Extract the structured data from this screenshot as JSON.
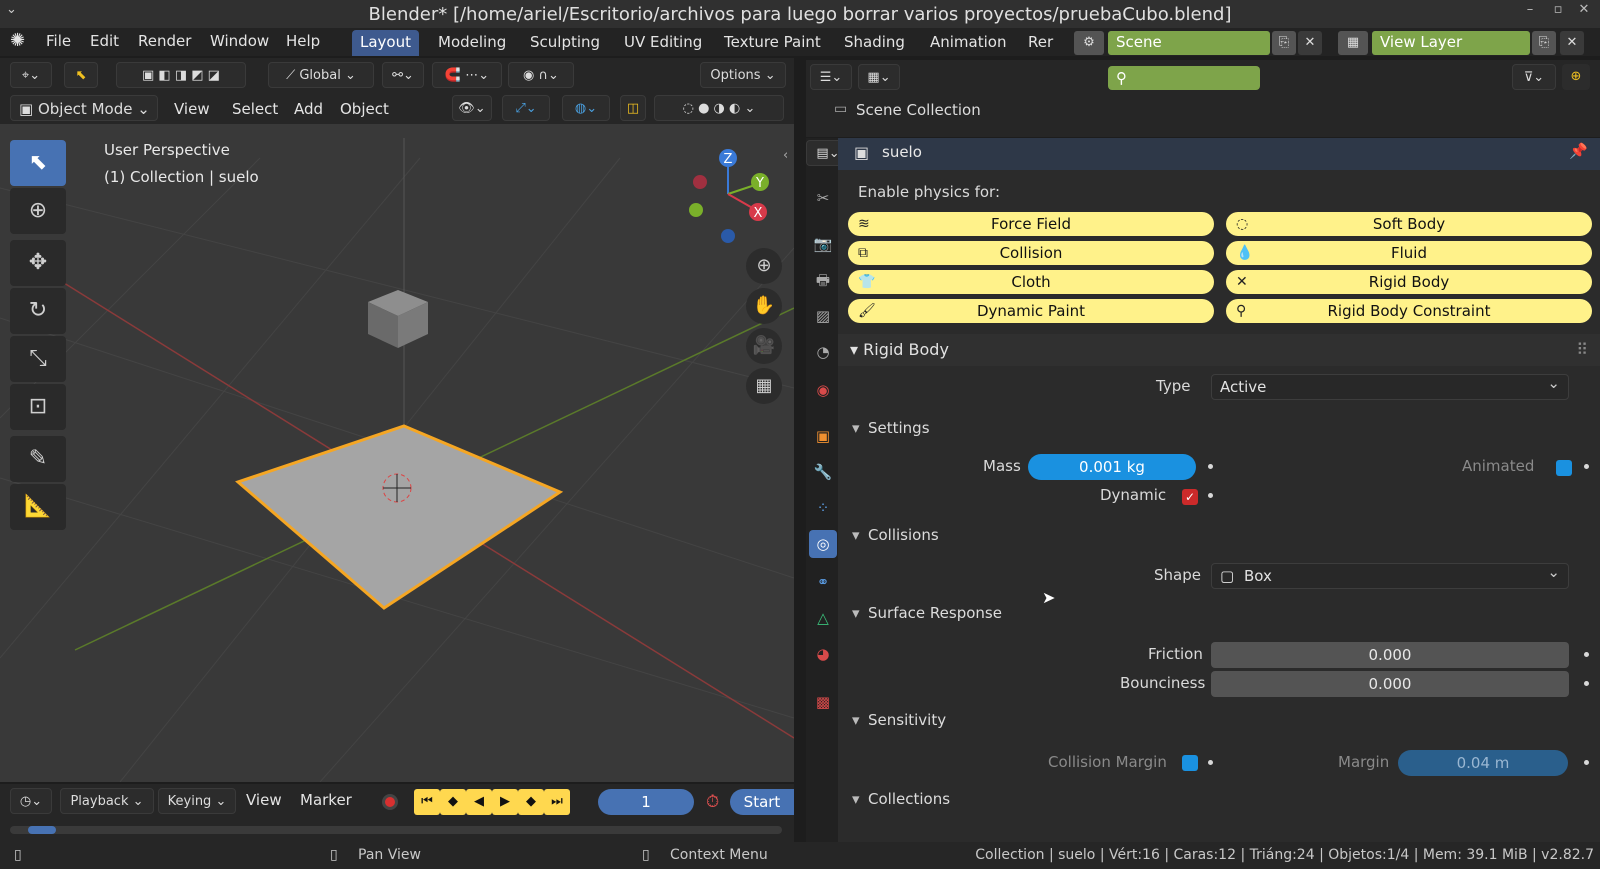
{
  "window": {
    "title": "Blender* [/home/ariel/Escritorio/archivos para luego borrar varios proyectos/pruebaCubo.blend]"
  },
  "topbar": {
    "menus": [
      "File",
      "Edit",
      "Render",
      "Window",
      "Help"
    ],
    "workspace_tabs": [
      "Layout",
      "Modeling",
      "Sculpting",
      "UV Editing",
      "Texture Paint",
      "Shading",
      "Animation",
      "Rer"
    ],
    "active_tab": "Layout",
    "scene": "Scene",
    "view_layer": "View Layer"
  },
  "viewport": {
    "transform_orientation": "Global",
    "options_label": "Options",
    "mode": "Object Mode",
    "header_menus": [
      "View",
      "Select",
      "Add",
      "Object"
    ],
    "overlay_line1": "User Perspective",
    "overlay_line2": "(1) Collection | suelo",
    "gizmo_axes": {
      "z": "Z",
      "y": "Y",
      "x": "X"
    }
  },
  "timeline": {
    "playback": "Playback",
    "keying": "Keying",
    "view": "View",
    "marker": "Marker",
    "current_frame": "1",
    "start_label": "Start"
  },
  "statusbar": {
    "pan": "Pan View",
    "context": "Context Menu",
    "stats": "Collection | suelo | Vért:16 | Caras:12 | Triáng:24 | Objetos:1/4 | Mem: 39.1 MiB | v2.82.7"
  },
  "outliner": {
    "scene_collection": "Scene Collection"
  },
  "properties": {
    "object_name": "suelo",
    "enable_physics_label": "Enable physics for:",
    "physics_buttons": [
      {
        "label": "Force Field",
        "icon": "force-field-icon"
      },
      {
        "label": "Soft Body",
        "icon": "soft-body-icon"
      },
      {
        "label": "Collision",
        "icon": "collision-icon"
      },
      {
        "label": "Fluid",
        "icon": "fluid-icon"
      },
      {
        "label": "Cloth",
        "icon": "cloth-icon"
      },
      {
        "label": "Rigid Body",
        "icon": "remove-icon"
      },
      {
        "label": "Dynamic Paint",
        "icon": "dynamic-paint-icon"
      },
      {
        "label": "Rigid Body Constraint",
        "icon": "constraint-icon"
      }
    ],
    "rigid_body": {
      "header": "Rigid Body",
      "type_label": "Type",
      "type_value": "Active",
      "settings_header": "Settings",
      "mass_label": "Mass",
      "mass_value": "0.001 kg",
      "animated_label": "Animated",
      "dynamic_label": "Dynamic",
      "collisions_header": "Collisions",
      "shape_label": "Shape",
      "shape_value": "Box",
      "surface_header": "Surface Response",
      "friction_label": "Friction",
      "friction_value": "0.000",
      "bounciness_label": "Bounciness",
      "bounciness_value": "0.000",
      "sensitivity_header": "Sensitivity",
      "collision_margin_label": "Collision Margin",
      "margin_label": "Margin",
      "margin_value": "0.04 m",
      "collections_header": "Collections"
    }
  },
  "colors": {
    "accent_blue": "#4772b3",
    "physics_yellow": "#fff28a",
    "scene_green": "#7ea44a",
    "selection_orange": "#f5a623"
  }
}
